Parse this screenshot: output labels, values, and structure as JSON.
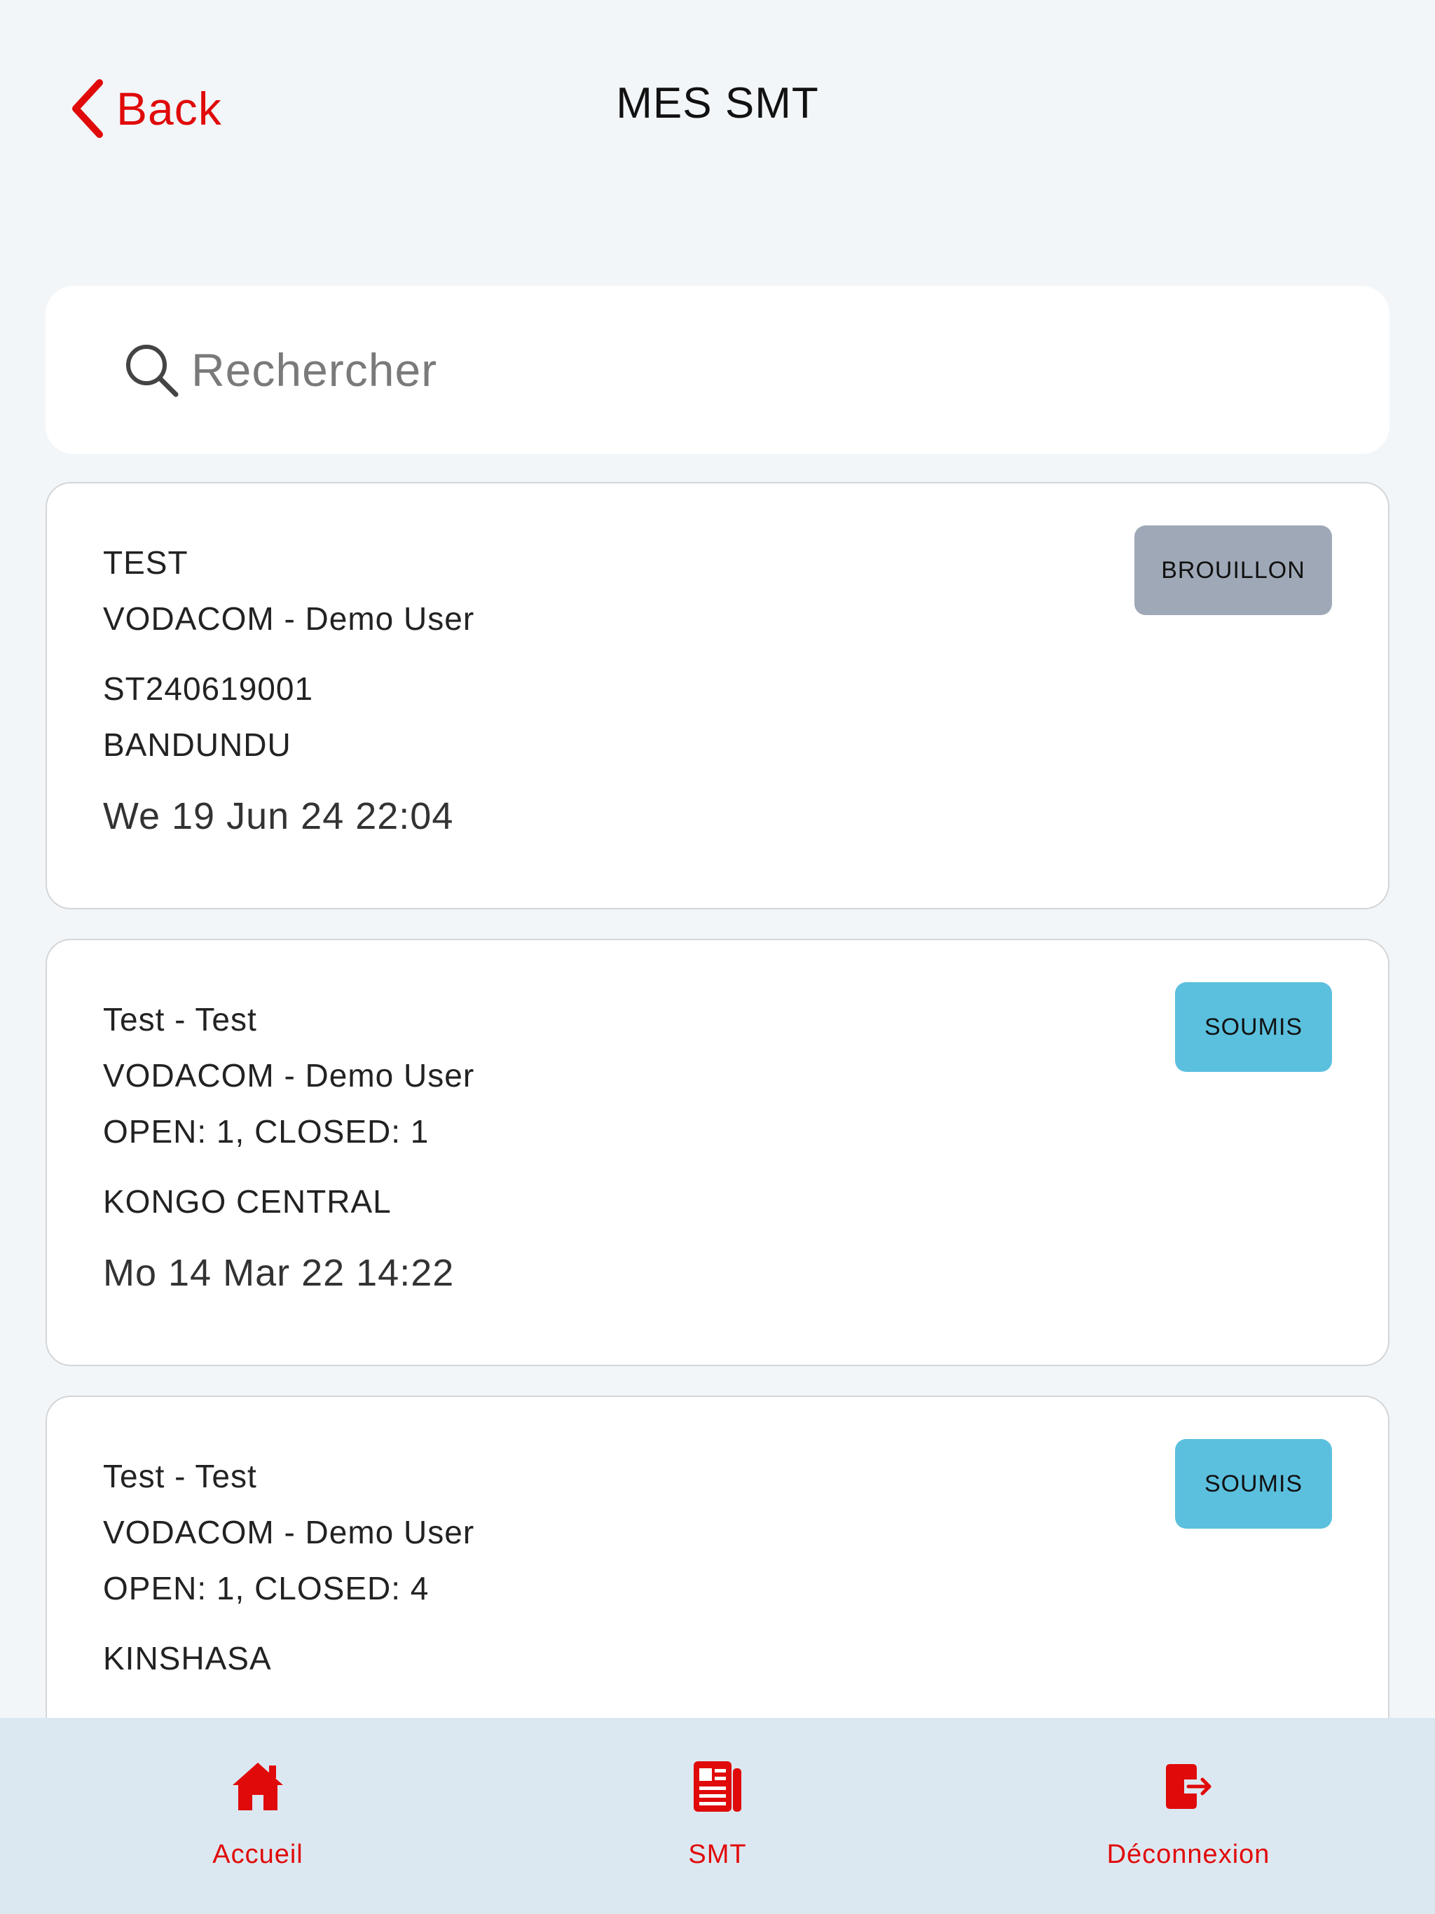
{
  "header": {
    "back_label": "Back",
    "title": "MES SMT"
  },
  "search": {
    "placeholder": "Rechercher",
    "value": ""
  },
  "cards": [
    {
      "lines": [
        "TEST",
        "VODACOM - Demo User",
        "ST240619001",
        "BANDUNDU"
      ],
      "date": "We 19 Jun 24 22:04",
      "status": "BROUILLON"
    },
    {
      "lines": [
        "Test - Test",
        "VODACOM - Demo User",
        "OPEN: 1, CLOSED: 1",
        "KONGO CENTRAL"
      ],
      "date": "Mo 14 Mar 22 14:22",
      "status": "SOUMIS"
    },
    {
      "lines": [
        "Test - Test",
        "VODACOM - Demo User",
        "OPEN: 1, CLOSED: 4",
        "KINSHASA"
      ],
      "status": "SOUMIS"
    }
  ],
  "tabbar": {
    "home_label": "Accueil",
    "smt_label": "SMT",
    "logout_label": "Déconnexion"
  },
  "colors": {
    "accent": "#e00a0a",
    "background": "#f2f6f9",
    "tabbar": "#dce8f1",
    "badge_draft": "#9fa8b6",
    "badge_submitted": "#5bc0de"
  },
  "icons": {
    "back": "chevron-left-icon",
    "search": "search-icon",
    "home": "home-icon",
    "smt": "newspaper-icon",
    "logout": "logout-icon"
  }
}
